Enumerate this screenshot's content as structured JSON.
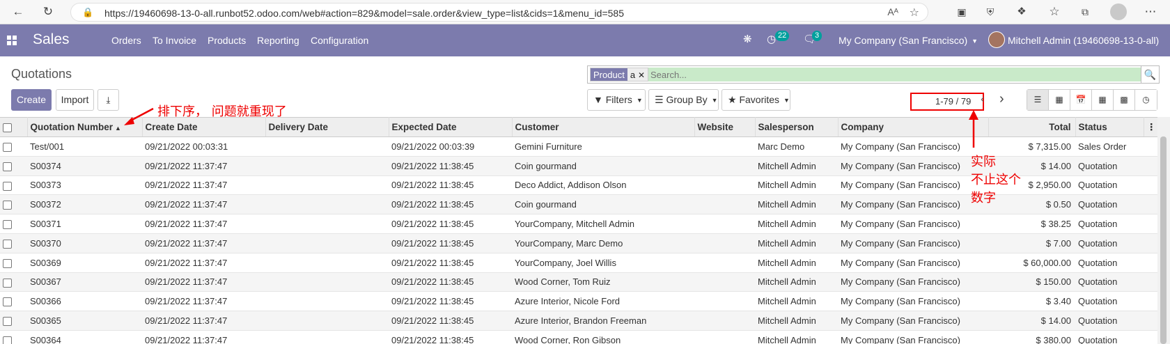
{
  "browser": {
    "url": "https://19460698-13-0-all.runbot52.odoo.com/web#action=829&model=sale.order&view_type=list&cids=1&menu_id=585",
    "read_aloud": "Aᴬ"
  },
  "navbar": {
    "brand": "Sales",
    "menu": [
      "Orders",
      "To Invoice",
      "Products",
      "Reporting",
      "Configuration"
    ],
    "activity_count": "22",
    "message_count": "3",
    "company": "My Company (San Francisco)",
    "user": "Mitchell Admin (19460698-13-0-all)"
  },
  "control": {
    "title": "Quotations",
    "create_label": "Create",
    "import_label": "Import",
    "facet_label": "Product",
    "facet_value": "a",
    "search_placeholder": "Search...",
    "filters_label": "Filters",
    "groupby_label": "Group By",
    "favorites_label": "Favorites",
    "pager": "1-79 / 79"
  },
  "table": {
    "columns": [
      "Quotation Number",
      "Create Date",
      "Delivery Date",
      "Expected Date",
      "Customer",
      "Website",
      "Salesperson",
      "Company",
      "Total",
      "Status"
    ],
    "rows": [
      [
        "Test/001",
        "09/21/2022 00:03:31",
        "",
        "09/21/2022 00:03:39",
        "Gemini Furniture",
        "",
        "Marc Demo",
        "My Company (San Francisco)",
        "$ 7,315.00",
        "Sales Order"
      ],
      [
        "S00374",
        "09/21/2022 11:37:47",
        "",
        "09/21/2022 11:38:45",
        "Coin gourmand",
        "",
        "Mitchell Admin",
        "My Company (San Francisco)",
        "$ 14.00",
        "Quotation"
      ],
      [
        "S00373",
        "09/21/2022 11:37:47",
        "",
        "09/21/2022 11:38:45",
        "Deco Addict, Addison Olson",
        "",
        "Mitchell Admin",
        "My Company (San Francisco)",
        "$ 2,950.00",
        "Quotation"
      ],
      [
        "S00372",
        "09/21/2022 11:37:47",
        "",
        "09/21/2022 11:38:45",
        "Coin gourmand",
        "",
        "Mitchell Admin",
        "My Company (San Francisco)",
        "$ 0.50",
        "Quotation"
      ],
      [
        "S00371",
        "09/21/2022 11:37:47",
        "",
        "09/21/2022 11:38:45",
        "YourCompany, Mitchell Admin",
        "",
        "Mitchell Admin",
        "My Company (San Francisco)",
        "$ 38.25",
        "Quotation"
      ],
      [
        "S00370",
        "09/21/2022 11:37:47",
        "",
        "09/21/2022 11:38:45",
        "YourCompany, Marc Demo",
        "",
        "Mitchell Admin",
        "My Company (San Francisco)",
        "$ 7.00",
        "Quotation"
      ],
      [
        "S00369",
        "09/21/2022 11:37:47",
        "",
        "09/21/2022 11:38:45",
        "YourCompany, Joel Willis",
        "",
        "Mitchell Admin",
        "My Company (San Francisco)",
        "$ 60,000.00",
        "Quotation"
      ],
      [
        "S00367",
        "09/21/2022 11:37:47",
        "",
        "09/21/2022 11:38:45",
        "Wood Corner, Tom Ruiz",
        "",
        "Mitchell Admin",
        "My Company (San Francisco)",
        "$ 150.00",
        "Quotation"
      ],
      [
        "S00366",
        "09/21/2022 11:37:47",
        "",
        "09/21/2022 11:38:45",
        "Azure Interior, Nicole Ford",
        "",
        "Mitchell Admin",
        "My Company (San Francisco)",
        "$ 3.40",
        "Quotation"
      ],
      [
        "S00365",
        "09/21/2022 11:37:47",
        "",
        "09/21/2022 11:38:45",
        "Azure Interior, Brandon Freeman",
        "",
        "Mitchell Admin",
        "My Company (San Francisco)",
        "$ 14.00",
        "Quotation"
      ],
      [
        "S00364",
        "09/21/2022 11:37:47",
        "",
        "09/21/2022 11:38:45",
        "Wood Corner, Ron Gibson",
        "",
        "Mitchell Admin",
        "My Company (San Francisco)",
        "$ 380.00",
        "Quotation"
      ]
    ]
  },
  "annotations": {
    "sort_note": "排下序，  问题就重现了",
    "pager_note_1": "实际",
    "pager_note_2": "不止这个",
    "pager_note_3": "数字"
  },
  "colors": {
    "primary": "#7c7bad",
    "badge": "#00a09d",
    "annotation": "#e00000",
    "search_fill": "#c9eac9"
  }
}
